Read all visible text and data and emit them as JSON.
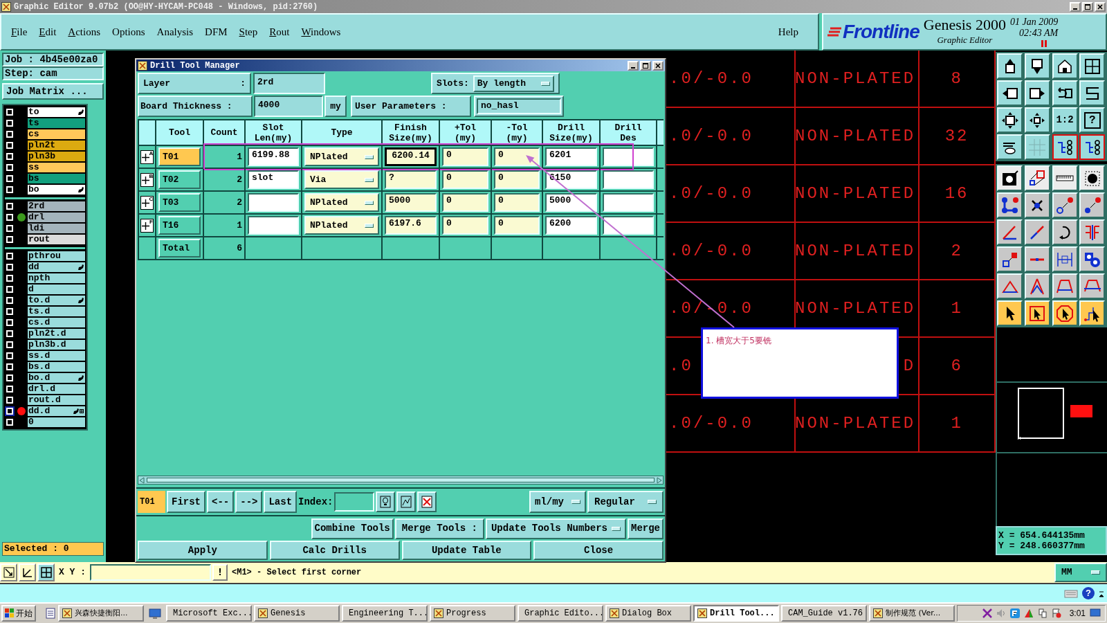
{
  "window": {
    "title": "Graphic Editor 9.07b2 (OO@HY-HYCAM-PC048 - Windows, pid:2760)"
  },
  "menu": [
    {
      "label": "File",
      "mnemonic": true
    },
    {
      "label": "Edit",
      "mnemonic": true
    },
    {
      "label": "Actions",
      "mnemonic": true
    },
    {
      "label": "Options",
      "mnemonic": false
    },
    {
      "label": "Analysis",
      "mnemonic": false
    },
    {
      "label": "DFM",
      "mnemonic": false
    },
    {
      "label": "Step",
      "mnemonic": true
    },
    {
      "label": "Rout",
      "mnemonic": true
    },
    {
      "label": "Windows",
      "mnemonic": true
    }
  ],
  "help": "Help",
  "brand": {
    "logo": "Frontline",
    "product": "Genesis 2000",
    "subtitle": "Graphic Editor",
    "date": "01 Jan 2009",
    "time": "02:43 AM"
  },
  "job": {
    "job": "Job : 4b45e00za0",
    "step": "Step: cam",
    "matrix": "Job Matrix ..."
  },
  "layer_groups": [
    {
      "layers": [
        {
          "name": "to",
          "color": "#ffffff",
          "pointer": true,
          "linked": false,
          "active": false
        },
        {
          "name": "ts",
          "color": "#12a07e",
          "pointer": false,
          "linked": false,
          "active": false
        },
        {
          "name": "cs",
          "color": "#ffc85a",
          "pointer": false,
          "linked": false,
          "active": false
        },
        {
          "name": "pln2t",
          "color": "#dcaa10",
          "pointer": false,
          "linked": false,
          "active": false
        },
        {
          "name": "pln3b",
          "color": "#dcaa10",
          "pointer": false,
          "linked": false,
          "active": false
        },
        {
          "name": "ss",
          "color": "#ffc85a",
          "pointer": false,
          "linked": false,
          "active": false
        },
        {
          "name": "bs",
          "color": "#12a07e",
          "pointer": false,
          "linked": false,
          "active": false
        },
        {
          "name": "bo",
          "color": "#ffffff",
          "pointer": true,
          "linked": false,
          "active": false
        }
      ]
    },
    {
      "layers": [
        {
          "name": "2rd",
          "color": "#a4b4bc",
          "pointer": false,
          "linked": false,
          "active": false
        },
        {
          "name": "drl",
          "color": "#a4b4bc",
          "dot": {
            "color": "#3c9a1e"
          },
          "pointer": false,
          "linked": false,
          "active": false
        },
        {
          "name": "ldi",
          "color": "#a4b4bc",
          "pointer": false,
          "linked": false,
          "active": false
        },
        {
          "name": "rout",
          "color": "#dcdcdc",
          "pointer": false,
          "linked": false,
          "active": false
        }
      ]
    },
    {
      "layers": [
        {
          "name": "pthrou",
          "color": "#9adcdc",
          "pointer": false,
          "linked": false,
          "active": false
        },
        {
          "name": "dd",
          "color": "#9adcdc",
          "pointer": true,
          "linked": false,
          "active": false
        },
        {
          "name": "npth",
          "color": "#9adcdc",
          "pointer": false,
          "linked": false,
          "active": false
        },
        {
          "name": "d",
          "color": "#9adcdc",
          "pointer": false,
          "linked": false,
          "active": false
        },
        {
          "name": "to.d",
          "color": "#9adcdc",
          "pointer": true,
          "linked": false,
          "active": false
        },
        {
          "name": "ts.d",
          "color": "#9adcdc",
          "pointer": false,
          "linked": false,
          "active": false
        },
        {
          "name": "cs.d",
          "color": "#9adcdc",
          "pointer": false,
          "linked": false,
          "active": false
        },
        {
          "name": "pln2t.d",
          "color": "#9adcdc",
          "pointer": false,
          "linked": false,
          "active": false
        },
        {
          "name": "pln3b.d",
          "color": "#9adcdc",
          "pointer": false,
          "linked": false,
          "active": false
        },
        {
          "name": "ss.d",
          "color": "#9adcdc",
          "pointer": false,
          "linked": false,
          "active": false
        },
        {
          "name": "bs.d",
          "color": "#9adcdc",
          "pointer": false,
          "linked": false,
          "active": false
        },
        {
          "name": "bo.d",
          "color": "#9adcdc",
          "pointer": true,
          "linked": false,
          "active": false
        },
        {
          "name": "drl.d",
          "color": "#9adcdc",
          "pointer": false,
          "linked": false,
          "active": false
        },
        {
          "name": "rout.d",
          "color": "#9adcdc",
          "pointer": false,
          "linked": false,
          "active": false
        },
        {
          "name": "dd.d",
          "color": "#9adcdc",
          "dot": {
            "color": "#ff1010"
          },
          "pointer": true,
          "linked": true,
          "active": true
        },
        {
          "name": "0",
          "color": "#9adcdc",
          "pointer": false,
          "linked": false,
          "active": false
        }
      ]
    }
  ],
  "selected_count": "Selected : 0",
  "canvas_rows": [
    {
      "tolerance": ".0/-0.0",
      "type": "NON-PLATED",
      "count": "8"
    },
    {
      "tolerance": ".0/-0.0",
      "type": "NON-PLATED",
      "count": "32"
    },
    {
      "tolerance": ".0/-0.0",
      "type": "NON-PLATED",
      "count": "16"
    },
    {
      "tolerance": ".0/-0.0",
      "type": "NON-PLATED",
      "count": "2"
    },
    {
      "tolerance": ".0/-0.0",
      "type": "NON-PLATED",
      "count": "1"
    },
    {
      "tolerance": ".0",
      "type": "D",
      "count": "6"
    },
    {
      "tolerance": ".0/-0.0",
      "type": "NON-PLATED",
      "count": "1"
    }
  ],
  "note": {
    "text": "1. 槽宽大于5要铣"
  },
  "dialog": {
    "title": "Drill Tool Manager",
    "layer": {
      "label": "Layer",
      "sep": ":",
      "value": "2rd"
    },
    "slots": {
      "label": "Slots:",
      "value": "By length"
    },
    "thickness": {
      "label": "Board Thickness :",
      "value": "4000",
      "unit": "my"
    },
    "user_params": {
      "label": "User Parameters :",
      "value": "no_hasl"
    },
    "columns": [
      "Tool",
      "Count",
      "Slot Len(my)",
      "Type",
      "Finish Size(my)",
      "+Tol (my)",
      "-Tol (my)",
      "Drill Size(my)",
      "Drill Des"
    ],
    "rows": [
      {
        "badge": "A",
        "tool": "T01",
        "selected": true,
        "highlighted": true,
        "count": "1",
        "slot_len": "6199.88",
        "type": "NPlated",
        "finish": "6200.14",
        "finish_focused": true,
        "plus_tol": "0",
        "minus_tol": "0",
        "drill_size": "6201"
      },
      {
        "badge": "B",
        "tool": "T02",
        "selected": false,
        "highlighted": false,
        "count": "2",
        "slot_len": "slot",
        "type": "Via",
        "finish": "?",
        "finish_focused": false,
        "plus_tol": "0",
        "minus_tol": "0",
        "drill_size": "6150"
      },
      {
        "badge": "C",
        "tool": "T03",
        "selected": false,
        "highlighted": false,
        "count": "2",
        "type": "NPlated",
        "finish": "5000",
        "finish_focused": false,
        "plus_tol": "0",
        "minus_tol": "0",
        "drill_size": "5000"
      },
      {
        "badge": "F",
        "tool": "T16",
        "selected": false,
        "highlighted": false,
        "count": "1",
        "type": "NPlated",
        "finish": "6197.6",
        "finish_focused": false,
        "plus_tol": "0",
        "minus_tol": "0",
        "drill_size": "6200"
      }
    ],
    "total": {
      "label": "Total",
      "count": "6"
    },
    "nav": {
      "current": "T01",
      "buttons": [
        "First",
        "<--",
        "-->",
        "Last"
      ],
      "index_label": "Index:",
      "units": "ml/my",
      "mode": "Regular"
    },
    "merge": {
      "combine": "Combine Tools",
      "label": "Merge Tools :",
      "option": "Update Tools Numbers",
      "merge": "Merge"
    },
    "actions": [
      "Apply",
      "Calc Drills",
      "Update Table",
      "Close"
    ]
  },
  "toolbar": {
    "ratio": "1:2",
    "help": "?"
  },
  "coordinates": {
    "x": "X = 654.644135mm",
    "y": "Y = 248.660377mm"
  },
  "command_line": {
    "label": "X Y :",
    "alert": "!",
    "prompt": "<M1> - Select first corner",
    "units": "MM"
  },
  "status": {
    "help": "?"
  },
  "taskbar": {
    "start": "开始",
    "tasks": [
      {
        "label": "兴森快捷衡阳...",
        "selected": false
      },
      {
        "label": "Microsoft Exc...",
        "selected": false
      },
      {
        "label": "Genesis",
        "selected": false
      },
      {
        "label": "Engineering T...",
        "selected": false
      },
      {
        "label": "Progress",
        "selected": false
      },
      {
        "label": "Graphic Edito...",
        "selected": false
      },
      {
        "label": "Dialog Box",
        "selected": false
      },
      {
        "label": "Drill Tool...",
        "selected": true
      },
      {
        "label": "CAM_Guide v1.76",
        "selected": false
      },
      {
        "label": "制作规范 (Ver...",
        "selected": false
      }
    ],
    "clock": "3:01"
  }
}
